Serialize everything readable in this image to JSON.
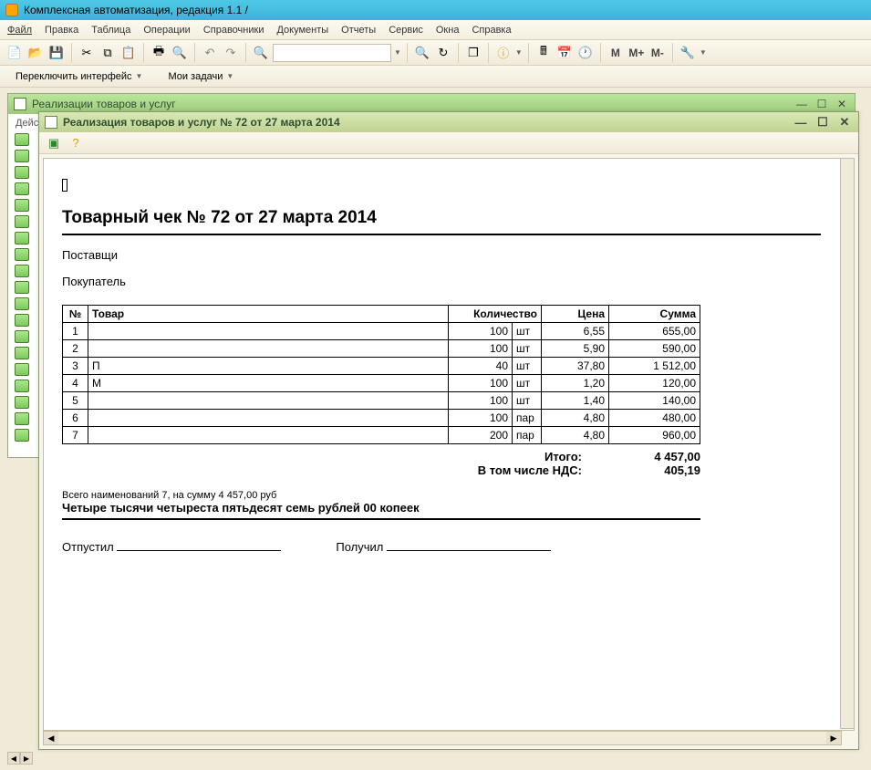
{
  "app": {
    "title": "Комплексная автоматизация, редакция 1.1 /"
  },
  "menu": {
    "file": "Файл",
    "edit": "Правка",
    "table": "Таблица",
    "ops": "Операции",
    "ref": "Справочники",
    "docs": "Документы",
    "rep": "Отчеты",
    "svc": "Сервис",
    "win": "Окна",
    "help": "Справка"
  },
  "toolbar2": {
    "switch_iface": "Переключить интерфейс",
    "my_tasks": "Мои задачи"
  },
  "calc": {
    "m": "M",
    "mplus": "M+",
    "mminus": "M-"
  },
  "win1": {
    "title": "Реализации товаров и услуг",
    "actions": "Дейс"
  },
  "win2": {
    "title": "Реализация товаров и услуг № 72 от 27 марта 2014"
  },
  "doc": {
    "title": "Товарный чек № 72 от 27 марта 2014",
    "supplier_label": "Поставщи",
    "buyer_label": "Покупатель",
    "th": {
      "num": "№",
      "prod": "Товар",
      "qty": "Количество",
      "price": "Цена",
      "sum": "Сумма"
    },
    "rows": [
      {
        "n": "1",
        "prod": "",
        "qty": "100",
        "unit": "шт",
        "price": "6,55",
        "sum": "655,00"
      },
      {
        "n": "2",
        "prod": "",
        "qty": "100",
        "unit": "шт",
        "price": "5,90",
        "sum": "590,00"
      },
      {
        "n": "3",
        "prod": "П",
        "qty": "40",
        "unit": "шт",
        "price": "37,80",
        "sum": "1 512,00"
      },
      {
        "n": "4",
        "prod": "М",
        "qty": "100",
        "unit": "шт",
        "price": "1,20",
        "sum": "120,00"
      },
      {
        "n": "5",
        "prod": "",
        "qty": "100",
        "unit": "шт",
        "price": "1,40",
        "sum": "140,00"
      },
      {
        "n": "6",
        "prod": "",
        "qty": "100",
        "unit": "пар",
        "price": "4,80",
        "sum": "480,00"
      },
      {
        "n": "7",
        "prod": "",
        "qty": "200",
        "unit": "пар",
        "price": "4,80",
        "sum": "960,00"
      }
    ],
    "total_label": "Итого:",
    "total": "4 457,00",
    "vat_label": "В том числе НДС:",
    "vat": "405,19",
    "summary_small": "Всего наименований 7, на сумму 4 457,00 руб",
    "summary_bold": "Четыре тысячи четыреста пятьдесят семь рублей 00 копеек",
    "released": "Отпустил",
    "received": "Получил"
  }
}
